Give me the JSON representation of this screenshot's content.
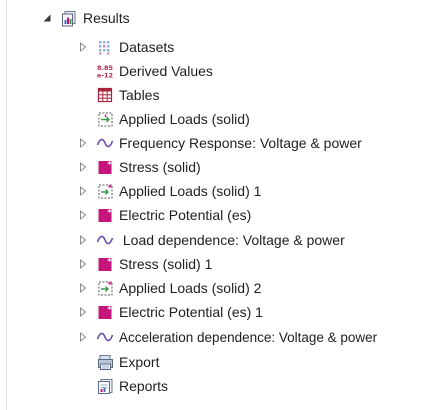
{
  "tree": {
    "root": {
      "label": "Results",
      "icon": "results-folder-icon",
      "expanded": true
    },
    "items": [
      {
        "label": "Datasets",
        "icon": "datasets-icon",
        "expandable": true
      },
      {
        "label": "Derived Values",
        "icon": "derived-values-icon",
        "icon_text": "8.85\ne-12",
        "expandable": false
      },
      {
        "label": "Tables",
        "icon": "table-icon",
        "expandable": false
      },
      {
        "label": "Applied Loads (solid)",
        "icon": "applied-loads-icon",
        "expandable": false
      },
      {
        "label": "Frequency Response: Voltage & power",
        "icon": "line-plot-icon",
        "expandable": true
      },
      {
        "label": "Stress (solid)",
        "icon": "plot-group-3d-icon",
        "expandable": true
      },
      {
        "label": "Applied Loads (solid) 1",
        "icon": "applied-loads-icon",
        "expandable": true
      },
      {
        "label": "Electric Potential (es)",
        "icon": "plot-group-3d-icon",
        "expandable": true
      },
      {
        "label": " Load dependence: Voltage & power",
        "icon": "line-plot-icon",
        "expandable": true
      },
      {
        "label": "Stress (solid) 1",
        "icon": "plot-group-3d-icon",
        "expandable": true
      },
      {
        "label": "Applied Loads (solid) 2",
        "icon": "applied-loads-icon",
        "expandable": true
      },
      {
        "label": "Electric Potential (es) 1",
        "icon": "plot-group-3d-icon",
        "expandable": true
      },
      {
        "label": "Acceleration dependence: Voltage & power",
        "icon": "line-plot-icon",
        "expandable": true
      },
      {
        "label": "Export",
        "icon": "export-icon",
        "expandable": false
      },
      {
        "label": "Reports",
        "icon": "reports-icon",
        "expandable": false
      }
    ]
  },
  "colors": {
    "plot_icon_magenta": "#c3157a",
    "curve_purple": "#6a4aa8",
    "twisty_gray": "#8a8a8a",
    "root_twisty": "#3a3a3a",
    "derived_red": "#b42a4a",
    "table_red": "#a8243c"
  }
}
